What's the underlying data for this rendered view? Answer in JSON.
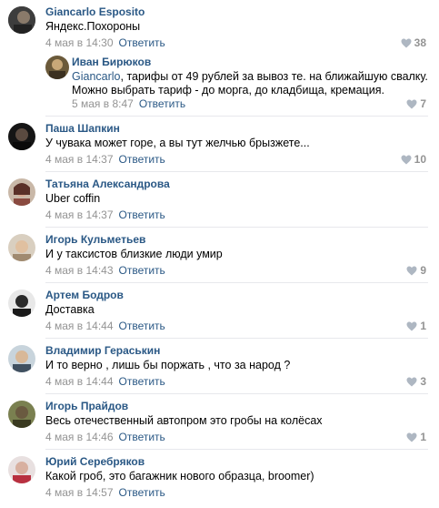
{
  "comments": [
    {
      "author": "Giancarlo Esposito",
      "text": "Яндекс.Похороны",
      "date": "4 мая в 14:30",
      "reply": "Ответить",
      "likes": "38",
      "avatar_color": "#4a4a4a"
    },
    {
      "author": "Иван Бирюков",
      "mention": "Giancarlo",
      "text_line1": ", тарифы от 49 рублей за вывоз те. на ближайшую свалку.",
      "text_line2": "Можно выбрать тариф - до морга, до кладбища, кремация.",
      "date": "5 мая в 8:47",
      "reply": "Ответить",
      "likes": "7",
      "avatar_color": "#6b5a3a"
    },
    {
      "author": "Паша Шапкин",
      "text": "У чувака может горе, а вы тут желчью брызжете...",
      "date": "4 мая в 14:37",
      "reply": "Ответить",
      "likes": "10",
      "avatar_color": "#1e1e1e"
    },
    {
      "author": "Татьяна Александрова",
      "text": "Uber coffin",
      "date": "4 мая в 14:37",
      "reply": "Ответить",
      "likes": "",
      "avatar_color": "#8a5a50"
    },
    {
      "author": "Игорь Кульметьев",
      "text": "И у таксистов близкие люди умир",
      "date": "4 мая в 14:43",
      "reply": "Ответить",
      "likes": "9",
      "avatar_color": "#b9a48a"
    },
    {
      "author": "Артем Бодров",
      "text": "Доставка",
      "date": "4 мая в 14:44",
      "reply": "Ответить",
      "likes": "1",
      "avatar_color": "#3b3b3b"
    },
    {
      "author": "Владимир Гераськин",
      "text": "И то верно , лишь бы поржать , что за народ ?",
      "date": "4 мая в 14:44",
      "reply": "Ответить",
      "likes": "3",
      "avatar_color": "#7d8a95"
    },
    {
      "author": "Игорь Прайдов",
      "text": "Весь отечественный автопром это гробы на колёсах",
      "date": "4 мая в 14:46",
      "reply": "Ответить",
      "likes": "1",
      "avatar_color": "#5d6a3e"
    },
    {
      "author": "Юрий Серебряков",
      "text": "Какой гроб, это багажник нового образца, broomer)",
      "date": "4 мая в 14:57",
      "reply": "Ответить",
      "likes": "",
      "avatar_color": "#b44a52"
    }
  ],
  "icons": {
    "like": "heart-icon"
  }
}
